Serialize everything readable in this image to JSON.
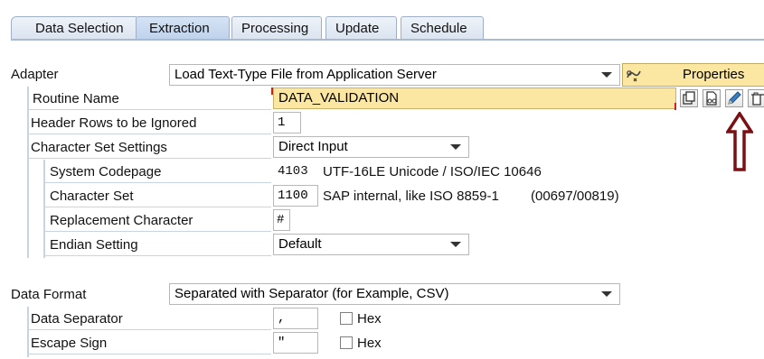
{
  "tabs": [
    {
      "label": "Data Selection",
      "active": false
    },
    {
      "label": "Extraction",
      "active": true
    },
    {
      "label": "Processing",
      "active": false
    },
    {
      "label": "Update",
      "active": false
    },
    {
      "label": "Schedule",
      "active": false
    }
  ],
  "adapter": {
    "label": "Adapter",
    "value": "Load Text-Type File from Application Server",
    "properties_label": "Properties"
  },
  "routine": {
    "label": "Routine Name",
    "value": "DATA_VALIDATION"
  },
  "header_rows": {
    "label": "Header Rows to be Ignored",
    "value": "1"
  },
  "charset_settings": {
    "label": "Character Set Settings",
    "value": "Direct Input"
  },
  "system_codepage": {
    "label": "System Codepage",
    "code": "4103",
    "desc": "UTF-16LE Unicode / ISO/IEC 10646"
  },
  "character_set": {
    "label": "Character Set",
    "code": "1100",
    "desc": "SAP internal, like ISO 8859-1",
    "extra": "(00697/00819)"
  },
  "replacement_char": {
    "label": "Replacement Character",
    "value": "#"
  },
  "endian": {
    "label": "Endian Setting",
    "value": "Default"
  },
  "data_format": {
    "label": "Data Format",
    "value": "Separated with Separator (for Example, CSV)"
  },
  "data_separator": {
    "label": "Data Separator",
    "value": ",",
    "hex_label": "Hex"
  },
  "escape_sign": {
    "label": "Escape Sign",
    "value": "\"",
    "hex_label": "Hex"
  },
  "colors": {
    "highlight_field": "#fbe7a1",
    "annotation_arrow": "#7a0f14",
    "tab_active": "#c6d8ef"
  }
}
